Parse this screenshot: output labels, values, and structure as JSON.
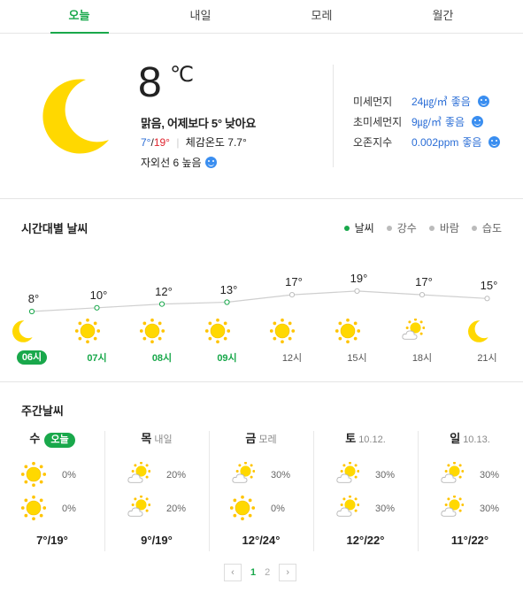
{
  "tabs": [
    {
      "label": "오늘",
      "active": true
    },
    {
      "label": "내일",
      "active": false
    },
    {
      "label": "모레",
      "active": false
    },
    {
      "label": "월간",
      "active": false
    }
  ],
  "current": {
    "icon": "moon-icon",
    "temp": "8",
    "unit": "℃",
    "condition": "맑음, 어제보다 5° 낮아요",
    "min": "7°",
    "slash": "/",
    "max": "19°",
    "feels_like": "체감온도 7.7°",
    "uv": "자외선 6 높음"
  },
  "air_quality": [
    {
      "label": "미세먼지",
      "value": "24㎍/㎥",
      "status": "좋음"
    },
    {
      "label": "초미세먼지",
      "value": "9㎍/㎥",
      "status": "좋음"
    },
    {
      "label": "오존지수",
      "value": "0.002ppm",
      "status": "좋음"
    }
  ],
  "hourly": {
    "title": "시간대별 날씨",
    "legend": [
      {
        "label": "날씨",
        "active": true
      },
      {
        "label": "강수",
        "active": false
      },
      {
        "label": "바람",
        "active": false
      },
      {
        "label": "습도",
        "active": false
      }
    ],
    "items": [
      {
        "temp": "8°",
        "value": 8,
        "icon": "moon-icon",
        "time": "06시",
        "style": "pill"
      },
      {
        "temp": "10°",
        "value": 10,
        "icon": "sun-icon",
        "time": "07시",
        "style": "green"
      },
      {
        "temp": "12°",
        "value": 12,
        "icon": "sun-icon",
        "time": "08시",
        "style": "green"
      },
      {
        "temp": "13°",
        "value": 13,
        "icon": "sun-icon",
        "time": "09시",
        "style": "green"
      },
      {
        "temp": "17°",
        "value": 17,
        "icon": "sun-icon",
        "time": "12시",
        "style": "gray"
      },
      {
        "temp": "19°",
        "value": 19,
        "icon": "sun-icon",
        "time": "15시",
        "style": "gray"
      },
      {
        "temp": "17°",
        "value": 17,
        "icon": "sun-cloud-icon",
        "time": "18시",
        "style": "gray"
      },
      {
        "temp": "15°",
        "value": 15,
        "icon": "moon-icon",
        "time": "21시",
        "style": "gray"
      }
    ]
  },
  "weekly": {
    "title": "주간날씨",
    "days": [
      {
        "name": "수",
        "sub": "",
        "today": "오늘",
        "am_icon": "sun-icon",
        "am_rain": "0%",
        "pm_icon": "sun-icon",
        "pm_rain": "0%",
        "temps": "7°/19°"
      },
      {
        "name": "목",
        "sub": "내일",
        "today": "",
        "am_icon": "sun-cloud-icon",
        "am_rain": "20%",
        "pm_icon": "sun-cloud-icon",
        "pm_rain": "20%",
        "temps": "9°/19°"
      },
      {
        "name": "금",
        "sub": "모레",
        "today": "",
        "am_icon": "sun-cloud-icon",
        "am_rain": "30%",
        "pm_icon": "sun-icon",
        "pm_rain": "0%",
        "temps": "12°/24°"
      },
      {
        "name": "토",
        "sub": "10.12.",
        "today": "",
        "am_icon": "sun-cloud-icon",
        "am_rain": "30%",
        "pm_icon": "sun-cloud-icon",
        "pm_rain": "30%",
        "temps": "12°/22°"
      },
      {
        "name": "일",
        "sub": "10.13.",
        "today": "",
        "am_icon": "sun-cloud-icon",
        "am_rain": "30%",
        "pm_icon": "sun-cloud-icon",
        "pm_rain": "30%",
        "temps": "11°/22°"
      }
    ]
  },
  "pager": {
    "prev": "‹",
    "pages": [
      "1",
      "2"
    ],
    "current": "1",
    "next": "›"
  },
  "colors": {
    "accent": "#19a84b",
    "min": "#2a6dd6",
    "max": "#e0242e",
    "sun": "#ffd800",
    "moon": "#ffd800",
    "status": "#2a6dd6"
  }
}
